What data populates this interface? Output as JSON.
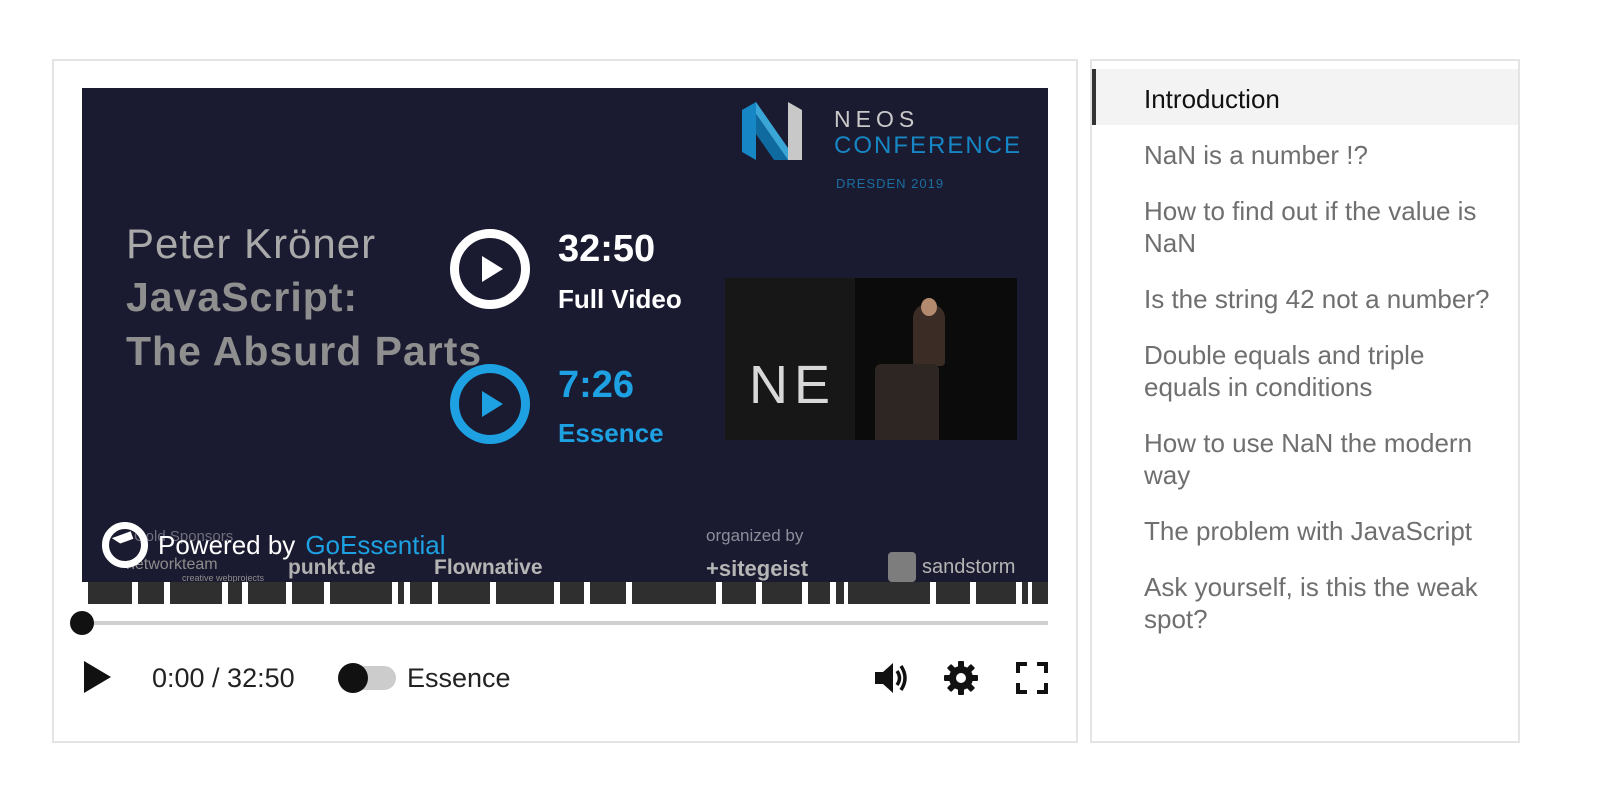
{
  "video": {
    "event": {
      "title": "NEOS",
      "subtitle": "CONFERENCE",
      "city": "DRESDEN 2019"
    },
    "speaker": "Peter Kröner",
    "talk_line1": "JavaScript:",
    "talk_line2": "The Absurd Parts",
    "options": {
      "full": {
        "time": "32:50",
        "label": "Full Video"
      },
      "essence": {
        "time": "7:26",
        "label": "Essence"
      }
    },
    "stage_text": "NE",
    "sponsors_label": "Gold Sponsors",
    "sponsors": [
      "networkteam",
      "creative webprojects",
      "punkt.de",
      "Flownative"
    ],
    "organized_label": "organized by",
    "organizers": [
      "+sitegeist",
      "sandstorm"
    ],
    "powered_by": "Powered by",
    "powered_brand": "GoEssential"
  },
  "player": {
    "progress": 0.0,
    "time": "0:00 / 32:50",
    "essence_toggle": {
      "label": "Essence",
      "on": false
    }
  },
  "chapters": [
    {
      "title": "Introduction",
      "active": true
    },
    {
      "title": "NaN is a number !?",
      "active": false
    },
    {
      "title": "How to find out if the value is NaN",
      "active": false
    },
    {
      "title": "Is the string 42 not a number?",
      "active": false
    },
    {
      "title": "Double equals and triple equals in conditions",
      "active": false
    },
    {
      "title": "How to use NaN the modern way",
      "active": false
    },
    {
      "title": "The problem with JavaScript",
      "active": false
    },
    {
      "title": "Ask yourself, is this the weak spot?",
      "active": false
    }
  ],
  "colors": {
    "accent": "#1da1e2",
    "video_bg": "#1a1a30",
    "active_chapter_bg": "#f3f3f3"
  },
  "icons": {
    "play": "play-icon",
    "volume": "volume-icon",
    "settings": "gear-icon",
    "fullscreen": "fullscreen-icon"
  }
}
